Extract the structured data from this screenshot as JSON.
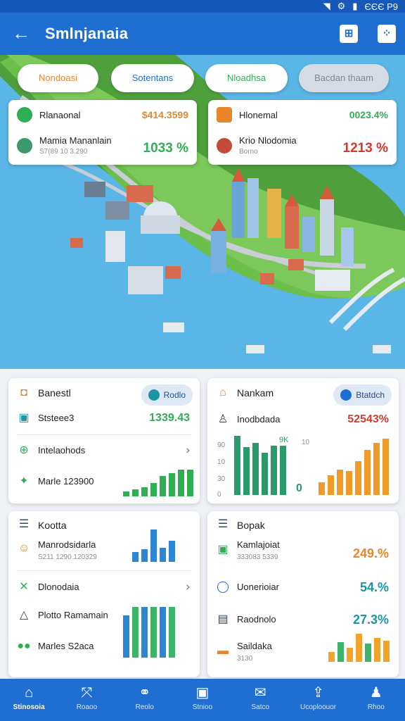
{
  "status": {
    "time": "ЄЄЄ Р9"
  },
  "app": {
    "title": "Smlnjanaia"
  },
  "chips": [
    "Nondoasi",
    "Sotentans",
    "Nloadhsa",
    "Bacdan thaam"
  ],
  "info_left": {
    "row1": {
      "label": "Rlanaonal",
      "value": "$414.3599"
    },
    "row2": {
      "label": "Mamia Mananlain",
      "sub": "S7(89 10 3.290",
      "value": "1033 %"
    }
  },
  "info_right": {
    "row1": {
      "label": "Hlonemal",
      "value": "0023.4%"
    },
    "row2": {
      "label": "Krio Nlodomia",
      "sub": "Borno",
      "value": "1213 %"
    }
  },
  "panel_a": {
    "title": "Banestl",
    "pill": "Rodlo",
    "row1": {
      "label": "Ststeee3",
      "value": "1339.43"
    },
    "row2": {
      "label": "Intelaohods"
    },
    "row3": {
      "label": "Marle 123900"
    },
    "bars": [
      16,
      22,
      28,
      42,
      64,
      72,
      84,
      84
    ]
  },
  "panel_b": {
    "title": "Nankam",
    "pill": "Btatdch",
    "row1": {
      "label": "Inodbdada",
      "value": "52543%"
    },
    "axis": [
      "90",
      "10",
      "30",
      "0"
    ],
    "annot": [
      "9K",
      "10"
    ],
    "bottom_label": "0",
    "bars_green": [
      84,
      68,
      74,
      60,
      70,
      70
    ],
    "bars_orange": [
      18,
      28,
      36,
      34,
      48,
      64,
      74,
      80
    ]
  },
  "panel_c": {
    "title": "Kootta",
    "row1": {
      "label": "Manrodsidarla",
      "sub": "S211 1290 120329"
    },
    "row2": {
      "label": "Dlonodaia"
    },
    "row3": {
      "label": "Plotto Ramamain"
    },
    "row4": {
      "label": "Marles S2aca"
    },
    "bars_top": [
      14,
      18,
      46,
      20,
      30
    ],
    "bars_bottom": [
      60,
      72,
      72,
      72,
      72,
      72
    ]
  },
  "panel_d": {
    "title": "Bopak",
    "row1": {
      "label": "Kamlajoiat",
      "sub": "333083 5339",
      "value": "249.%"
    },
    "row2": {
      "label": "Uonerioiar",
      "value": "54.%"
    },
    "row3": {
      "label": "Raodnolo",
      "value": "27.3%"
    },
    "row4": {
      "label": "Saildaka",
      "sub": "3130"
    },
    "bars": [
      14,
      28,
      20,
      40,
      26,
      34,
      30
    ]
  },
  "bottom_nav": [
    "Stinosoia",
    "Roaoo",
    "Reolo",
    "Stnioo",
    "Satco",
    "Ucoploouor",
    "Rhoo"
  ],
  "colors": {
    "primary": "#1e6fd1",
    "green": "#2fae54",
    "red": "#d23a2f",
    "orange": "#e8862a",
    "teal": "#1a95a5"
  }
}
